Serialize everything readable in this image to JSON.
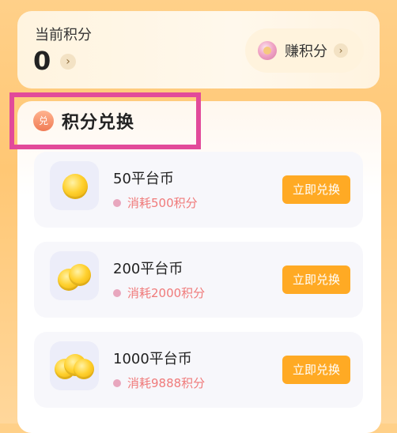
{
  "points": {
    "label": "当前积分",
    "value": "0",
    "arrow": "›"
  },
  "earn_button": {
    "label": "赚积分",
    "icon": "coin-stack-icon",
    "arrow": "›"
  },
  "section": {
    "icon_text": "兑",
    "title": "积分兑换"
  },
  "items": [
    {
      "name": "50平台币",
      "cost": "消耗500积分",
      "button": "立即兑换"
    },
    {
      "name": "200平台币",
      "cost": "消耗2000积分",
      "button": "立即兑换"
    },
    {
      "name": "1000平台币",
      "cost": "消耗9888积分",
      "button": "立即兑换"
    }
  ],
  "colors": {
    "accent": "#ffaa24",
    "highlight_border": "#e24a9a",
    "cost_text": "#f07a7a"
  }
}
